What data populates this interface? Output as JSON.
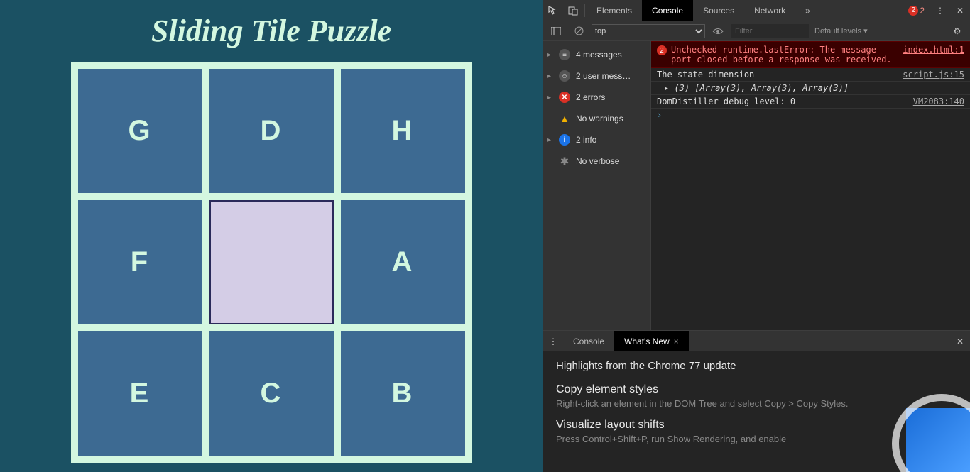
{
  "app": {
    "title": "Sliding Tile Puzzle",
    "tiles": [
      "G",
      "D",
      "H",
      "F",
      "",
      "A",
      "E",
      "C",
      "B"
    ],
    "empty_index": 4
  },
  "devtools": {
    "tabs": {
      "elements": "Elements",
      "console": "Console",
      "sources": "Sources",
      "network": "Network",
      "more": "»"
    },
    "error_count": "2",
    "toolbar": {
      "context": "top",
      "filter_placeholder": "Filter",
      "levels": "Default levels ▾"
    },
    "sidebar": {
      "messages": "4 messages",
      "user": "2 user mess…",
      "errors": "2 errors",
      "warnings": "No warnings",
      "info": "2 info",
      "verbose": "No verbose"
    },
    "log": {
      "err_badge": "2",
      "err_msg": "Unchecked runtime.lastError: The message port closed before a response was received.",
      "err_src": "index.html:1",
      "line1": "The state dimension",
      "line1_src": "script.js:15",
      "line2": "▸ (3) [Array(3), Array(3), Array(3)]",
      "line3": "DomDistiller debug level: 0",
      "line3_src": "VM2083:140",
      "prompt": "›"
    },
    "drawer": {
      "tab_console": "Console",
      "tab_whatsnew": "What's New",
      "heading": "Highlights from the Chrome 77 update",
      "item1_title": "Copy element styles",
      "item1_body": "Right-click an element in the DOM Tree and select Copy > Copy Styles.",
      "item2_title": "Visualize layout shifts",
      "item2_body": "Press Control+Shift+P, run Show Rendering, and enable"
    }
  }
}
